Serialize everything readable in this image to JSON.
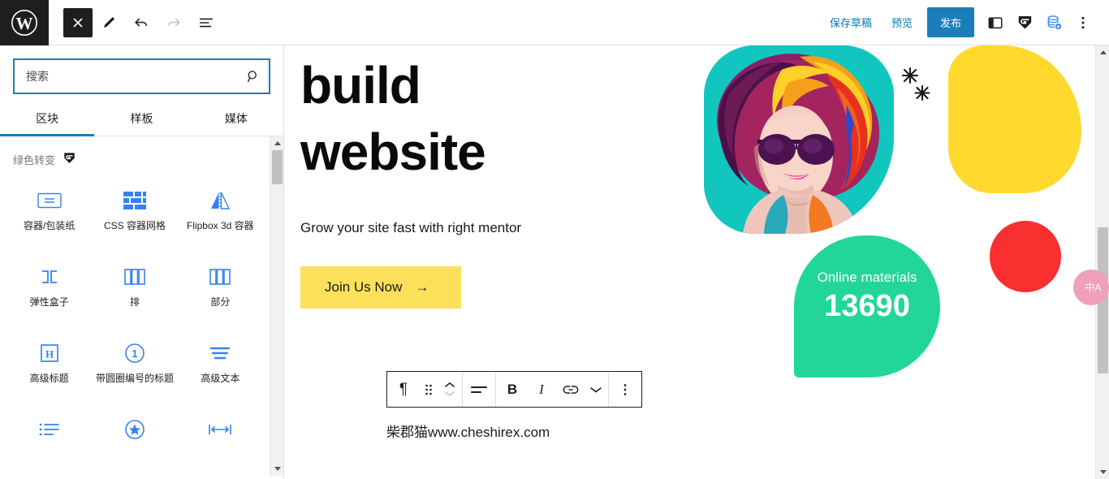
{
  "topbar": {
    "logo": "wordpress-logo",
    "left_buttons": [
      {
        "name": "close-button",
        "icon": "close-icon"
      },
      {
        "name": "edit-button",
        "icon": "pencil-icon"
      },
      {
        "name": "undo-button",
        "icon": "undo-icon"
      },
      {
        "name": "redo-button",
        "icon": "redo-icon"
      },
      {
        "name": "list-view-button",
        "icon": "list-view-icon"
      }
    ],
    "save_draft_label": "保存草稿",
    "preview_label": "预览",
    "publish_label": "发布",
    "right_icons": [
      {
        "name": "settings-sidebar-toggle",
        "icon": "sidebar-panel-icon"
      },
      {
        "name": "greenshift-logo",
        "icon": "g-shield-icon"
      },
      {
        "name": "database-save-button",
        "icon": "database-star-icon"
      },
      {
        "name": "options-menu-button",
        "icon": "kebab-menu-icon"
      }
    ]
  },
  "inserter": {
    "search_placeholder": "搜索",
    "search_value": "",
    "tabs": [
      {
        "label": "区块",
        "active": true
      },
      {
        "label": "样板",
        "active": false
      },
      {
        "label": "媒体",
        "active": false
      }
    ],
    "category_label": "绿色转变",
    "blocks": [
      {
        "label": "容器/包装纸",
        "icon": "container-wrapper-icon"
      },
      {
        "label": "CSS 容器网格",
        "icon": "css-grid-icon"
      },
      {
        "label": "Flipbox 3d 容器",
        "icon": "flipbox-3d-icon"
      },
      {
        "label": "弹性盒子",
        "icon": "flexbox-icon"
      },
      {
        "label": "排",
        "icon": "row-icon"
      },
      {
        "label": "部分",
        "icon": "section-icon"
      },
      {
        "label": "高级标题",
        "icon": "heading-h-icon"
      },
      {
        "label": "带圆圈编号的标题",
        "icon": "numbered-circle-icon"
      },
      {
        "label": "高级文本",
        "icon": "advanced-text-icon"
      },
      {
        "label": "",
        "icon": "bullet-list-icon"
      },
      {
        "label": "",
        "icon": "star-circle-icon"
      },
      {
        "label": "",
        "icon": "width-arrow-icon"
      }
    ]
  },
  "canvas": {
    "hero_title_line1": "build",
    "hero_title_line2": "website",
    "hero_subtitle": "Grow your site fast with right mentor",
    "cta_label": "Join Us Now",
    "cta_arrow": "→",
    "stat_label": "Online materials",
    "stat_value": "13690",
    "paragraph_text": "柴郡猫www.cheshirex.com",
    "image_alt": "portrait-colorful-hair-sunglasses"
  },
  "block_toolbar": {
    "buttons": [
      {
        "name": "block-type-paragraph",
        "icon": "paragraph-icon"
      },
      {
        "name": "drag-handle",
        "icon": "drag-dots-icon"
      },
      {
        "name": "move-up-down",
        "icon": "chevron-updown-icon"
      },
      {
        "name": "align-text-button",
        "icon": "align-left-icon"
      },
      {
        "name": "bold-button",
        "icon": "bold-icon"
      },
      {
        "name": "italic-button",
        "icon": "italic-icon"
      },
      {
        "name": "link-button",
        "icon": "link-icon"
      },
      {
        "name": "more-rich-text",
        "icon": "chevron-down-icon"
      },
      {
        "name": "block-options-menu",
        "icon": "kebab-menu-icon"
      }
    ],
    "bold_label": "B",
    "italic_label": "I",
    "paragraph_label": "¶"
  },
  "floating_tab": {
    "label": "中A"
  },
  "colors": {
    "accent_blue": "#1b7eba",
    "block_icon_blue": "#3582f5",
    "cta_yellow": "#fbe159",
    "blob_yellow": "#ffd92e",
    "blob_green": "#22d69a",
    "circle_red": "#fa2f2f",
    "portrait_bg": "#12c6c0",
    "pink_tab": "#f0a0bb"
  }
}
